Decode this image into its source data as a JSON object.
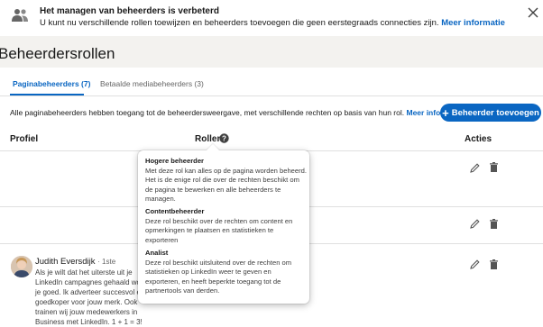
{
  "notice": {
    "title": "Het managen van beheerders is verbeterd",
    "body": "U kunt nu verschillende rollen toewijzen en beheerders toevoegen die geen eerstegraads connecties zijn.",
    "link": "Meer informatie"
  },
  "page_title": "Beheerdersrollen",
  "tabs": [
    {
      "label": "Paginabeheerders (7)"
    },
    {
      "label": "Betaalde mediabeheerders (3)"
    }
  ],
  "info": {
    "text": "Alle paginabeheerders hebben toegang tot de beheerdersweergave, met verschillende rechten op basis van hun rol.",
    "link": "Meer informatie"
  },
  "add_button": {
    "label": "Beheerder toevoegen"
  },
  "table": {
    "headers": {
      "profile": "Profiel",
      "roles": "Rollen",
      "actions": "Acties"
    }
  },
  "rows": [
    {},
    {},
    {
      "name": "Judith Eversdijk",
      "degree": "· 1ste",
      "bio": "Als je wilt dat het uiterste uit je LinkedIn campagnes gehaald wordt, zit je goed. Ik adverteer succesvol en goedkoper voor jouw merk. Ook trainen wij jouw medewerkers in Business met LinkedIn. 1 + 1 = 3!"
    }
  ],
  "tooltip": {
    "items": [
      {
        "title": "Hogere beheerder",
        "text": "Met deze rol kan alles op de pagina worden beheerd. Het is de enige rol die over de rechten beschikt om de pagina te bewerken en alle beheerders te managen."
      },
      {
        "title": "Contentbeheerder",
        "text": "Deze rol beschikt over de rechten om content en opmerkingen te plaatsen en statistieken te exporteren"
      },
      {
        "title": "Analist",
        "text": "Deze rol beschikt uitsluitend over de rechten om statistieken op LinkedIn weer te geven en exporteren, en heeft beperkte toegang tot de partnertools van derden."
      }
    ]
  },
  "colors": {
    "accent": "#0a66c2",
    "background": "#f3f2ef"
  },
  "icons": [
    "users-icon",
    "close-icon",
    "help-icon",
    "edit-icon",
    "trash-icon"
  ]
}
